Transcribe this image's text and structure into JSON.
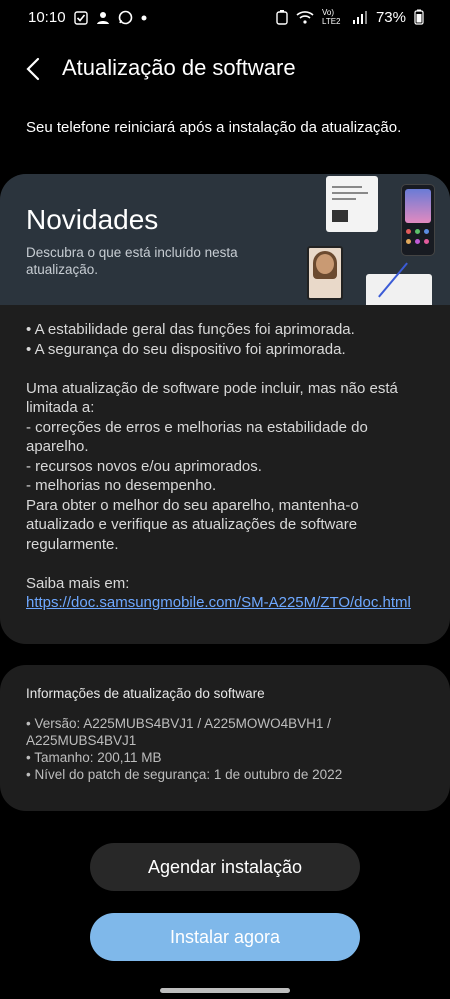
{
  "status_bar": {
    "time": "10:10",
    "network": "Vo) LTE2",
    "battery": "73%"
  },
  "app_bar": {
    "title": "Atualização de software"
  },
  "intro_text": "Seu telefone reiniciará após a instalação da atualização.",
  "news": {
    "title": "Novidades",
    "subtitle": "Descubra o que está incluído nesta atualização.",
    "bullets": [
      "• A estabilidade geral das funções foi aprimorada.",
      "• A segurança do seu dispositivo foi aprimorada."
    ],
    "lines": [
      "Uma atualização de software pode incluir, mas não está limitada a:",
      " - correções de erros e melhorias na estabilidade do aparelho.",
      " - recursos novos e/ou aprimorados.",
      " - melhorias no desempenho.",
      "Para obter o melhor do seu aparelho, mantenha-o atualizado e verifique as atualizações de software regularmente."
    ],
    "more_label": "Saiba mais em:",
    "more_link": "https://doc.samsungmobile.com/SM-A225M/ZTO/doc.html"
  },
  "info": {
    "title": "Informações de atualização do software",
    "version": "• Versão: A225MUBS4BVJ1 / A225MOWO4BVH1 / A225MUBS4BVJ1",
    "size": "• Tamanho: 200,11 MB",
    "patch": "• Nível do patch de segurança: 1 de outubro de 2022"
  },
  "buttons": {
    "schedule": "Agendar instalação",
    "install": "Instalar agora"
  },
  "colors": {
    "accent": "#7fb8ea",
    "link": "#6ea8ff",
    "card": "#1e1e1e",
    "header": "#2b343d"
  }
}
